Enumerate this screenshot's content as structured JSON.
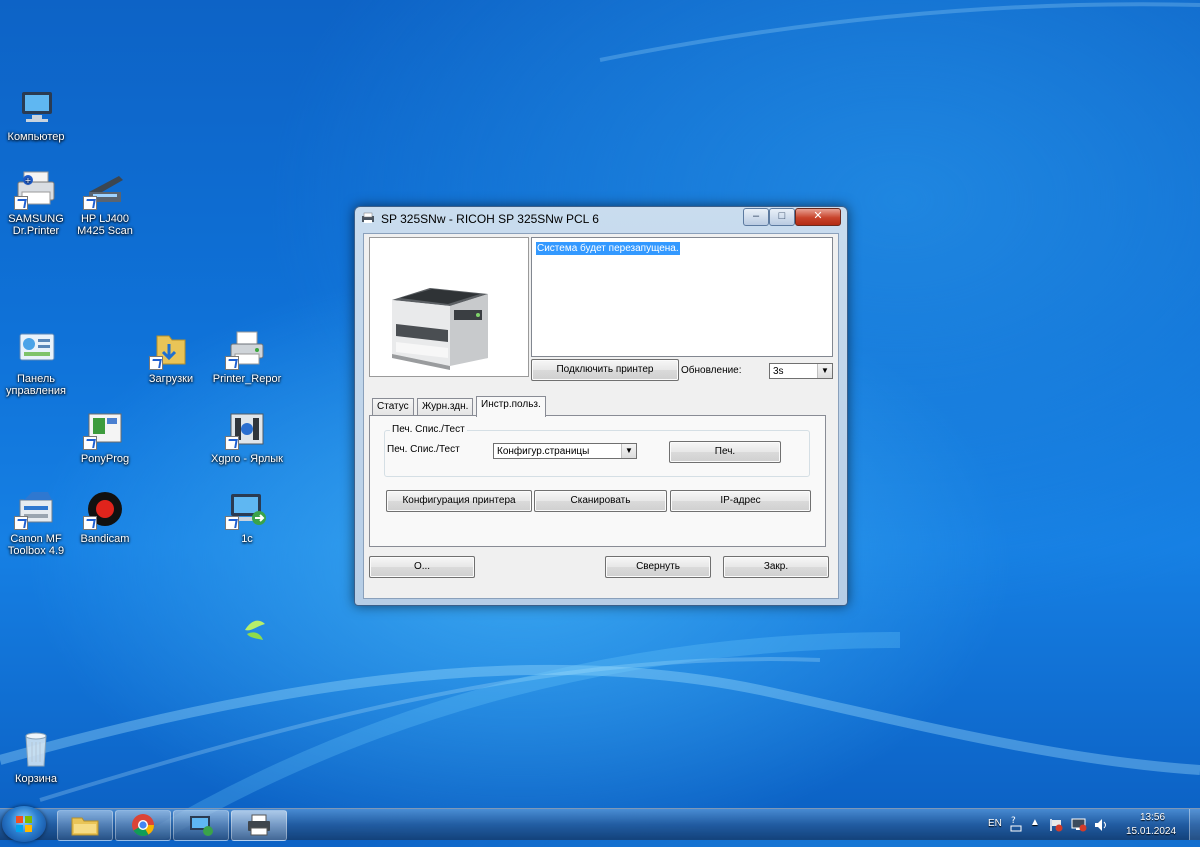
{
  "desktop": {
    "icons": [
      {
        "label": "Компьютер"
      },
      {
        "label": "SAMSUNG Dr.Printer"
      },
      {
        "label": "HP LJ400 M425 Scan"
      },
      {
        "label": "Панель управления"
      },
      {
        "label": "Загрузки"
      },
      {
        "label": "Printer_Repor"
      },
      {
        "label": "PonyProg"
      },
      {
        "label": "Xgpro - Ярлык"
      },
      {
        "label": "Canon MF Toolbox 4.9"
      },
      {
        "label": "Bandicam"
      },
      {
        "label": "1c"
      },
      {
        "label": "Корзина"
      }
    ]
  },
  "window": {
    "title": "SP 325SNw - RICOH SP 325SNw PCL 6",
    "message": "Система будет перезапущена.",
    "connect_button": "Подключить принтер",
    "refresh_label": "Обновление:",
    "refresh_value": "3s",
    "tabs": [
      {
        "label": "Статус"
      },
      {
        "label": "Журн.здн."
      },
      {
        "label": "Инстр.польз."
      }
    ],
    "group_title": "Печ. Спис./Тест",
    "print_list_label": "Печ. Спис./Тест",
    "print_list_value": "Конфигур.страницы",
    "print_button": "Печ.",
    "config_button": "Конфигурация принтера",
    "scan_button": "Сканировать",
    "ip_button": "IP-адрес",
    "about_button": "О...",
    "minimize_button": "Свернуть",
    "close_button": "Закр."
  },
  "taskbar": {
    "language": "EN",
    "time": "13:56",
    "date": "15.01.2024"
  }
}
